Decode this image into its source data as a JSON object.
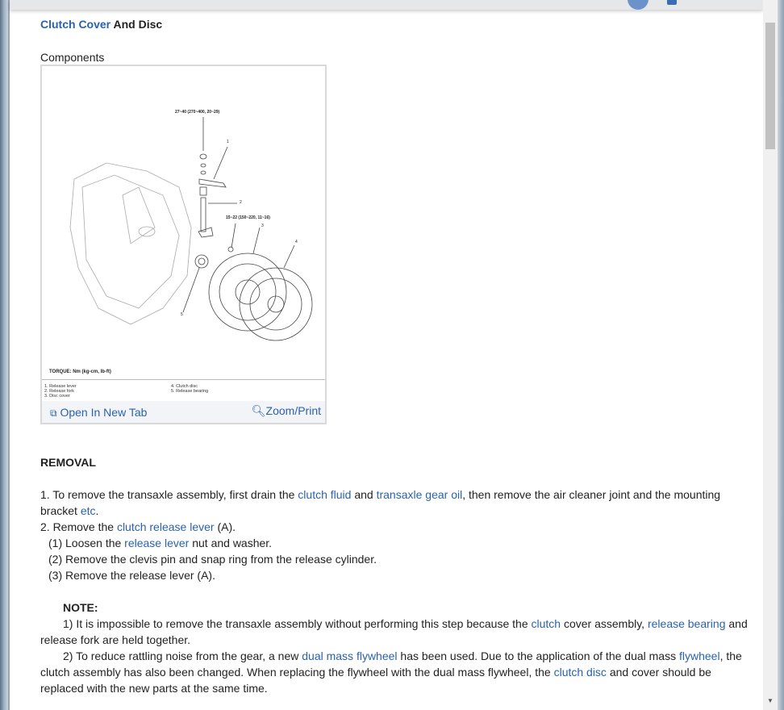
{
  "page": {
    "title_link": "Clutch Cover",
    "title_rest": " And Disc",
    "section": "Components"
  },
  "figure": {
    "torque1": "27~40 (270~400, 20~29)",
    "torque2": "15~22 (150~220, 11~16)",
    "callouts": [
      "1",
      "2",
      "3",
      "4",
      "5"
    ],
    "torque_label": "TORQUE: Nm (kg-cm, lb-ft)",
    "legend_col1": [
      "1. Release lever",
      "2. Release fork",
      "3. Disc cover"
    ],
    "legend_col2": [
      "4. Clutch disc",
      "5. Release bearing"
    ],
    "open_label": "Open In New Tab",
    "zoom_label": "Zoom/Print",
    "open_icon": "open-new-tab-icon",
    "zoom_icon": "magnifier-plus-icon"
  },
  "removal": {
    "heading": "REMOVAL",
    "s1": [
      " 1. To remove the transaxle assembly, first drain the ",
      "clutch fluid",
      " and ",
      "transaxle gear oil",
      ", then remove the air cleaner joint and the mounting bracket ",
      "etc",
      "."
    ],
    "s2": [
      " 2. Remove the ",
      "clutch release lever",
      " (A)."
    ],
    "s2a": [
      "    (1) Loosen the ",
      "release lever",
      " nut and washer."
    ],
    "s2b": "    (2) Remove the clevis pin and snap ring from the release cylinder.",
    "s2c": "    (3) Remove the release lever (A).",
    "note": "NOTE:",
    "n1": [
      "1) It is impossible to remove the transaxle assembly without performing this step because the ",
      "clutch",
      " cover assembly, ",
      "release bearing",
      " and release fork are held together."
    ],
    "n2": [
      "2) To reduce rattling noise from the gear, a new ",
      "dual mass flywheel",
      " has been used. Due to the application of the dual mass ",
      "flywheel",
      ", the clutch assembly has also been changed. When replacing the flywheel with the dual mass flywheel, the ",
      "clutch disc",
      " and cover should be replaced with the new parts at the same time."
    ]
  },
  "colors": {
    "link": "#2a62ad",
    "text": "#222222"
  }
}
